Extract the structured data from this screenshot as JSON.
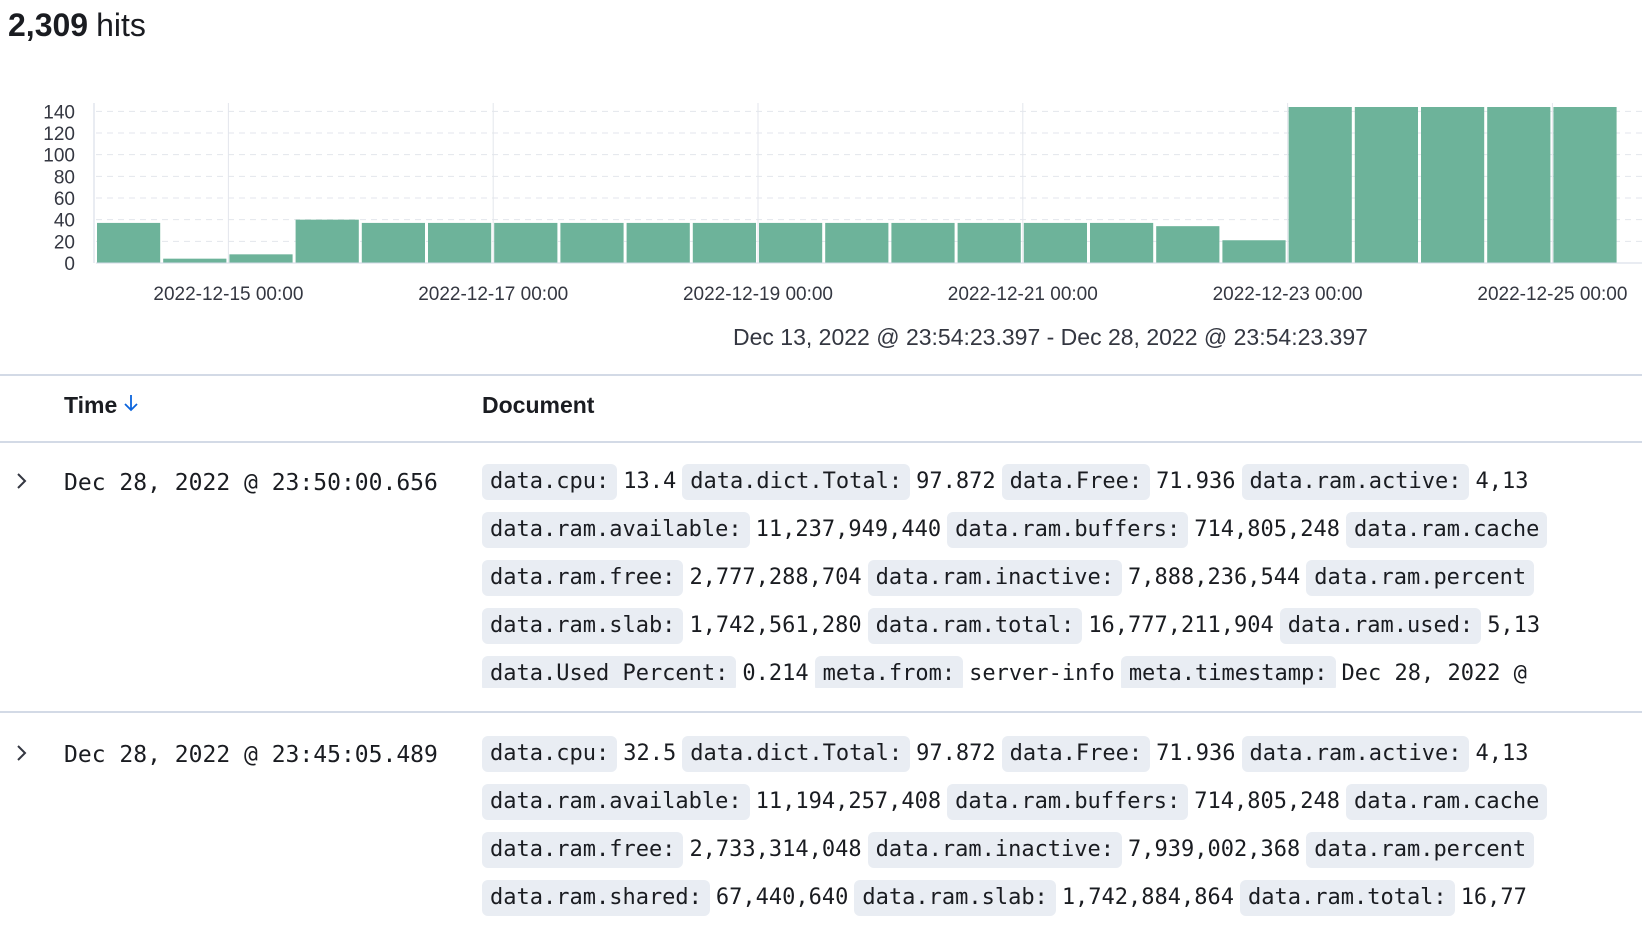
{
  "header": {
    "hit_count": "2,309",
    "hits_label": "hits"
  },
  "chart_data": {
    "type": "bar",
    "y_ticks": [
      "140",
      "120",
      "100",
      "80",
      "60",
      "40",
      "20",
      "0"
    ],
    "ylim": [
      0,
      144
    ],
    "x_labels": [
      "2022-12-15 00:00",
      "2022-12-17 00:00",
      "2022-12-19 00:00",
      "2022-12-21 00:00",
      "2022-12-23 00:00",
      "2022-12-25 00:00"
    ],
    "values": [
      37,
      4,
      8,
      40,
      37,
      37,
      37,
      37,
      37,
      37,
      37,
      37,
      37,
      37,
      37,
      37,
      34,
      21,
      144,
      144,
      144,
      144,
      144
    ],
    "bar_color": "#6db39a",
    "grid": true
  },
  "time_range": "Dec 13, 2022 @ 23:54:23.397 - Dec 28, 2022 @ 23:54:23.397",
  "table": {
    "time_header": "Time",
    "doc_header": "Document",
    "rows": [
      {
        "time": "Dec 28, 2022 @ 23:50:00.656",
        "lines": [
          [
            [
              "data.cpu:",
              "13.4"
            ],
            [
              "data.dict.Total:",
              "97.872"
            ],
            [
              "data.Free:",
              "71.936"
            ],
            [
              "data.ram.active:",
              "4,13"
            ]
          ],
          [
            [
              "data.ram.available:",
              "11,237,949,440"
            ],
            [
              "data.ram.buffers:",
              "714,805,248"
            ],
            [
              "data.ram.cache",
              ""
            ]
          ],
          [
            [
              "data.ram.free:",
              "2,777,288,704"
            ],
            [
              "data.ram.inactive:",
              "7,888,236,544"
            ],
            [
              "data.ram.percent",
              ""
            ]
          ],
          [
            [
              "data.ram.slab:",
              "1,742,561,280"
            ],
            [
              "data.ram.total:",
              "16,777,211,904"
            ],
            [
              "data.ram.used:",
              "5,13"
            ]
          ],
          [
            [
              "data.Used Percent:",
              "0.214"
            ],
            [
              "meta.from:",
              "server-info"
            ],
            [
              "meta.timestamp:",
              "Dec 28, 2022 @"
            ]
          ]
        ]
      },
      {
        "time": "Dec 28, 2022 @ 23:45:05.489",
        "lines": [
          [
            [
              "data.cpu:",
              "32.5"
            ],
            [
              "data.dict.Total:",
              "97.872"
            ],
            [
              "data.Free:",
              "71.936"
            ],
            [
              "data.ram.active:",
              "4,13"
            ]
          ],
          [
            [
              "data.ram.available:",
              "11,194,257,408"
            ],
            [
              "data.ram.buffers:",
              "714,805,248"
            ],
            [
              "data.ram.cache",
              ""
            ]
          ],
          [
            [
              "data.ram.free:",
              "2,733,314,048"
            ],
            [
              "data.ram.inactive:",
              "7,939,002,368"
            ],
            [
              "data.ram.percent",
              ""
            ]
          ],
          [
            [
              "data.ram.shared:",
              "67,440,640"
            ],
            [
              "data.ram.slab:",
              "1,742,884,864"
            ],
            [
              "data.ram.total:",
              "16,77"
            ]
          ]
        ]
      }
    ]
  }
}
